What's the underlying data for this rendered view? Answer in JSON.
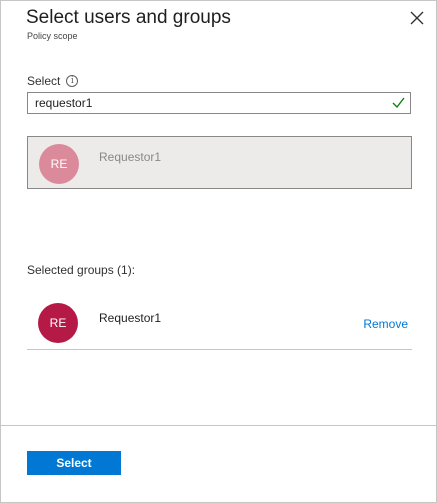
{
  "header": {
    "title": "Select users and groups",
    "subtitle": "Policy scope"
  },
  "colors": {
    "accent": "#0078d4",
    "search_avatar": "#db8a9b",
    "selected_avatar": "#b51a46",
    "check": "#107c10"
  },
  "search": {
    "label": "Select",
    "info_icon": "info-icon",
    "value": "requestor1",
    "valid_icon": "check-icon"
  },
  "results": [
    {
      "initials": "RE",
      "name": "Requestor1"
    }
  ],
  "selected": {
    "heading": "Selected groups (1):",
    "items": [
      {
        "initials": "RE",
        "name": "Requestor1",
        "action": "Remove"
      }
    ]
  },
  "footer": {
    "select_button": "Select"
  }
}
